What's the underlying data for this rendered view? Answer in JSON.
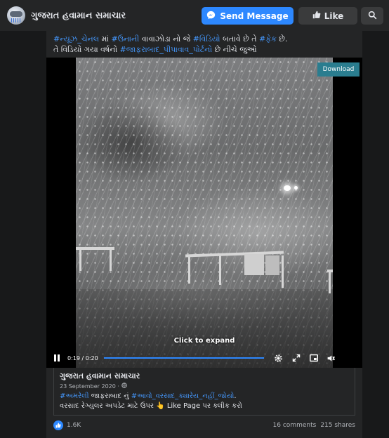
{
  "header": {
    "page_name": "ગુજરાત હવામાન સમાચાર",
    "send_message_label": "Send Message",
    "like_label": "Like"
  },
  "post": {
    "line1": [
      {
        "text": "#ન્યૂઝ_ચેનલ",
        "tag": true
      },
      {
        "text": " માં ",
        "tag": false
      },
      {
        "text": "#ઉનાની",
        "tag": true
      },
      {
        "text": " વાવાઝોડા નો જે ",
        "tag": false
      },
      {
        "text": "#વિડિયો",
        "tag": true
      },
      {
        "text": " બતાવે છે તે ",
        "tag": false
      },
      {
        "text": "#ફેક",
        "tag": true
      },
      {
        "text": " છે.",
        "tag": false
      }
    ],
    "line2": [
      {
        "text": "તે વિડિયો ગયા વર્ષનો ",
        "tag": false
      },
      {
        "text": "#જાફરાબાદ_પીપાવાવ_પોર્ટનો",
        "tag": true
      },
      {
        "text": " છે નીચે જુઓ",
        "tag": false
      }
    ]
  },
  "video": {
    "download_label": "Download",
    "expand_hint": "Click to expand",
    "time": "0:19 / 0:20",
    "progress": 0.95
  },
  "shared": {
    "name": "ગુજરાત હવામાન સમાચાર",
    "date": "23 September 2020 ·",
    "line1": [
      {
        "text": "#અમરેલી",
        "tag": true
      },
      {
        "text": " જાફરાબાદ નું ",
        "tag": false
      },
      {
        "text": "#આવો_વરસાદ_ક્યારેય_નહીં_જોયો",
        "tag": true
      },
      {
        "text": ".",
        "tag": false
      }
    ],
    "line2": "વરસાદ રેગ્યુલર અપડેટ માટે ઉપર 👆 Like Page પર ક્લીક કરો"
  },
  "stats": {
    "likes": "1.6K",
    "comments": "16 comments",
    "shares": "215 shares"
  },
  "colors": {
    "accent": "#2d88ff",
    "hashtag": "#4599ff",
    "download": "#2a7d8f"
  }
}
